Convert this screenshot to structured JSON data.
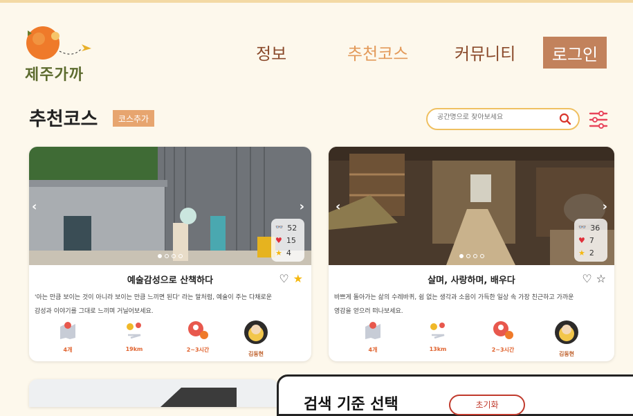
{
  "logo": {
    "text": "제주가까"
  },
  "nav": {
    "items": [
      "정보",
      "추천코스",
      "커뮤니티"
    ],
    "active_index": 1,
    "login": "로그인"
  },
  "header": {
    "title": "추천코스",
    "add_button": "코스추가"
  },
  "search": {
    "placeholder": "공간명으로 찾아보세요",
    "icon": "search-icon"
  },
  "colors": {
    "accent": "#e7a56f",
    "nav": "#8a4a2b",
    "login_bg": "#c2825c",
    "search_border": "#efc061",
    "meta": "#e0632f"
  },
  "cards": [
    {
      "title": "예술감성으로 산책하다",
      "desc_line1": "'아는 만큼 보이는 것이 아니라 보이는 만큼 느끼면 된다' 라는 말처럼, 예술이 주는 다채로운",
      "desc_line2": "감성과 이야기를 그대로 느끼며 거닐어보세요.",
      "stats": {
        "views": "52",
        "likes": "15",
        "stars": "4"
      },
      "liked": false,
      "starred": true,
      "meta": {
        "places": "4개",
        "distance": "19km",
        "duration": "2~3시간",
        "author": "김동현"
      }
    },
    {
      "title": "살며, 사랑하며, 배우다",
      "desc_line1": "바쁘게 돌아가는 삶의 수레바퀴, 쉼 없는 생각과 소음이 가득한 일상 속 가장 친근하고 가까운",
      "desc_line2": "영감을 얻으러 떠나보세요.",
      "stats": {
        "views": "36",
        "likes": "7",
        "stars": "2"
      },
      "liked": false,
      "starred": false,
      "meta": {
        "places": "4개",
        "distance": "13km",
        "duration": "2~3시간",
        "author": "김동현"
      }
    }
  ],
  "modal": {
    "title": "검색 기준 선택",
    "button": "초기화"
  }
}
